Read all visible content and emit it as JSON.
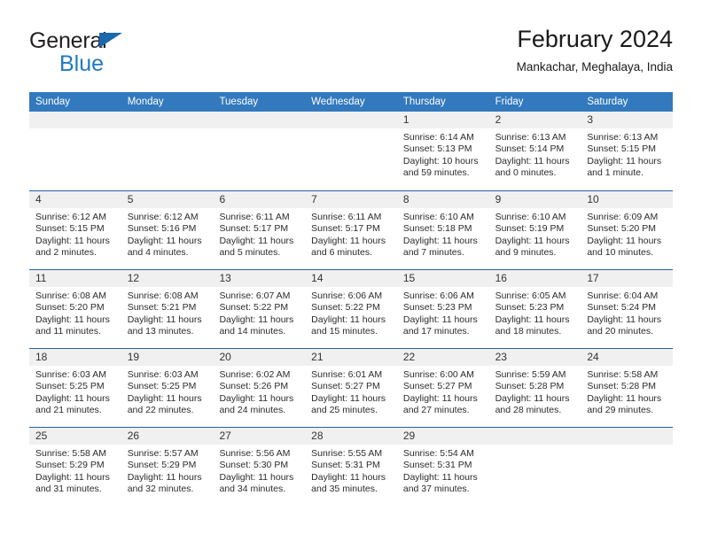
{
  "brand": {
    "name_part1": "General",
    "name_part2": "Blue",
    "accent_color": "#1f7ac0",
    "triangle_color": "#1b68ad"
  },
  "header": {
    "title": "February 2024",
    "subtitle": "Mankachar, Meghalaya, India"
  },
  "theme": {
    "header_bar_color": "#3279bd",
    "row_divider_color": "#2c5f96",
    "day_band_color": "#f0f0f0"
  },
  "weekdays": [
    "Sunday",
    "Monday",
    "Tuesday",
    "Wednesday",
    "Thursday",
    "Friday",
    "Saturday"
  ],
  "labels": {
    "sunrise": "Sunrise:",
    "sunset": "Sunset:",
    "daylight": "Daylight:"
  },
  "weeks": [
    [
      {
        "day": "",
        "sunrise": "",
        "sunset": "",
        "daylight_line1": "",
        "daylight_line2": ""
      },
      {
        "day": "",
        "sunrise": "",
        "sunset": "",
        "daylight_line1": "",
        "daylight_line2": ""
      },
      {
        "day": "",
        "sunrise": "",
        "sunset": "",
        "daylight_line1": "",
        "daylight_line2": ""
      },
      {
        "day": "",
        "sunrise": "",
        "sunset": "",
        "daylight_line1": "",
        "daylight_line2": ""
      },
      {
        "day": "1",
        "sunrise": "Sunrise: 6:14 AM",
        "sunset": "Sunset: 5:13 PM",
        "daylight_line1": "Daylight: 10 hours",
        "daylight_line2": "and 59 minutes."
      },
      {
        "day": "2",
        "sunrise": "Sunrise: 6:13 AM",
        "sunset": "Sunset: 5:14 PM",
        "daylight_line1": "Daylight: 11 hours",
        "daylight_line2": "and 0 minutes."
      },
      {
        "day": "3",
        "sunrise": "Sunrise: 6:13 AM",
        "sunset": "Sunset: 5:15 PM",
        "daylight_line1": "Daylight: 11 hours",
        "daylight_line2": "and 1 minute."
      }
    ],
    [
      {
        "day": "4",
        "sunrise": "Sunrise: 6:12 AM",
        "sunset": "Sunset: 5:15 PM",
        "daylight_line1": "Daylight: 11 hours",
        "daylight_line2": "and 2 minutes."
      },
      {
        "day": "5",
        "sunrise": "Sunrise: 6:12 AM",
        "sunset": "Sunset: 5:16 PM",
        "daylight_line1": "Daylight: 11 hours",
        "daylight_line2": "and 4 minutes."
      },
      {
        "day": "6",
        "sunrise": "Sunrise: 6:11 AM",
        "sunset": "Sunset: 5:17 PM",
        "daylight_line1": "Daylight: 11 hours",
        "daylight_line2": "and 5 minutes."
      },
      {
        "day": "7",
        "sunrise": "Sunrise: 6:11 AM",
        "sunset": "Sunset: 5:17 PM",
        "daylight_line1": "Daylight: 11 hours",
        "daylight_line2": "and 6 minutes."
      },
      {
        "day": "8",
        "sunrise": "Sunrise: 6:10 AM",
        "sunset": "Sunset: 5:18 PM",
        "daylight_line1": "Daylight: 11 hours",
        "daylight_line2": "and 7 minutes."
      },
      {
        "day": "9",
        "sunrise": "Sunrise: 6:10 AM",
        "sunset": "Sunset: 5:19 PM",
        "daylight_line1": "Daylight: 11 hours",
        "daylight_line2": "and 9 minutes."
      },
      {
        "day": "10",
        "sunrise": "Sunrise: 6:09 AM",
        "sunset": "Sunset: 5:20 PM",
        "daylight_line1": "Daylight: 11 hours",
        "daylight_line2": "and 10 minutes."
      }
    ],
    [
      {
        "day": "11",
        "sunrise": "Sunrise: 6:08 AM",
        "sunset": "Sunset: 5:20 PM",
        "daylight_line1": "Daylight: 11 hours",
        "daylight_line2": "and 11 minutes."
      },
      {
        "day": "12",
        "sunrise": "Sunrise: 6:08 AM",
        "sunset": "Sunset: 5:21 PM",
        "daylight_line1": "Daylight: 11 hours",
        "daylight_line2": "and 13 minutes."
      },
      {
        "day": "13",
        "sunrise": "Sunrise: 6:07 AM",
        "sunset": "Sunset: 5:22 PM",
        "daylight_line1": "Daylight: 11 hours",
        "daylight_line2": "and 14 minutes."
      },
      {
        "day": "14",
        "sunrise": "Sunrise: 6:06 AM",
        "sunset": "Sunset: 5:22 PM",
        "daylight_line1": "Daylight: 11 hours",
        "daylight_line2": "and 15 minutes."
      },
      {
        "day": "15",
        "sunrise": "Sunrise: 6:06 AM",
        "sunset": "Sunset: 5:23 PM",
        "daylight_line1": "Daylight: 11 hours",
        "daylight_line2": "and 17 minutes."
      },
      {
        "day": "16",
        "sunrise": "Sunrise: 6:05 AM",
        "sunset": "Sunset: 5:23 PM",
        "daylight_line1": "Daylight: 11 hours",
        "daylight_line2": "and 18 minutes."
      },
      {
        "day": "17",
        "sunrise": "Sunrise: 6:04 AM",
        "sunset": "Sunset: 5:24 PM",
        "daylight_line1": "Daylight: 11 hours",
        "daylight_line2": "and 20 minutes."
      }
    ],
    [
      {
        "day": "18",
        "sunrise": "Sunrise: 6:03 AM",
        "sunset": "Sunset: 5:25 PM",
        "daylight_line1": "Daylight: 11 hours",
        "daylight_line2": "and 21 minutes."
      },
      {
        "day": "19",
        "sunrise": "Sunrise: 6:03 AM",
        "sunset": "Sunset: 5:25 PM",
        "daylight_line1": "Daylight: 11 hours",
        "daylight_line2": "and 22 minutes."
      },
      {
        "day": "20",
        "sunrise": "Sunrise: 6:02 AM",
        "sunset": "Sunset: 5:26 PM",
        "daylight_line1": "Daylight: 11 hours",
        "daylight_line2": "and 24 minutes."
      },
      {
        "day": "21",
        "sunrise": "Sunrise: 6:01 AM",
        "sunset": "Sunset: 5:27 PM",
        "daylight_line1": "Daylight: 11 hours",
        "daylight_line2": "and 25 minutes."
      },
      {
        "day": "22",
        "sunrise": "Sunrise: 6:00 AM",
        "sunset": "Sunset: 5:27 PM",
        "daylight_line1": "Daylight: 11 hours",
        "daylight_line2": "and 27 minutes."
      },
      {
        "day": "23",
        "sunrise": "Sunrise: 5:59 AM",
        "sunset": "Sunset: 5:28 PM",
        "daylight_line1": "Daylight: 11 hours",
        "daylight_line2": "and 28 minutes."
      },
      {
        "day": "24",
        "sunrise": "Sunrise: 5:58 AM",
        "sunset": "Sunset: 5:28 PM",
        "daylight_line1": "Daylight: 11 hours",
        "daylight_line2": "and 29 minutes."
      }
    ],
    [
      {
        "day": "25",
        "sunrise": "Sunrise: 5:58 AM",
        "sunset": "Sunset: 5:29 PM",
        "daylight_line1": "Daylight: 11 hours",
        "daylight_line2": "and 31 minutes."
      },
      {
        "day": "26",
        "sunrise": "Sunrise: 5:57 AM",
        "sunset": "Sunset: 5:29 PM",
        "daylight_line1": "Daylight: 11 hours",
        "daylight_line2": "and 32 minutes."
      },
      {
        "day": "27",
        "sunrise": "Sunrise: 5:56 AM",
        "sunset": "Sunset: 5:30 PM",
        "daylight_line1": "Daylight: 11 hours",
        "daylight_line2": "and 34 minutes."
      },
      {
        "day": "28",
        "sunrise": "Sunrise: 5:55 AM",
        "sunset": "Sunset: 5:31 PM",
        "daylight_line1": "Daylight: 11 hours",
        "daylight_line2": "and 35 minutes."
      },
      {
        "day": "29",
        "sunrise": "Sunrise: 5:54 AM",
        "sunset": "Sunset: 5:31 PM",
        "daylight_line1": "Daylight: 11 hours",
        "daylight_line2": "and 37 minutes."
      },
      {
        "day": "",
        "sunrise": "",
        "sunset": "",
        "daylight_line1": "",
        "daylight_line2": ""
      },
      {
        "day": "",
        "sunrise": "",
        "sunset": "",
        "daylight_line1": "",
        "daylight_line2": ""
      }
    ]
  ]
}
